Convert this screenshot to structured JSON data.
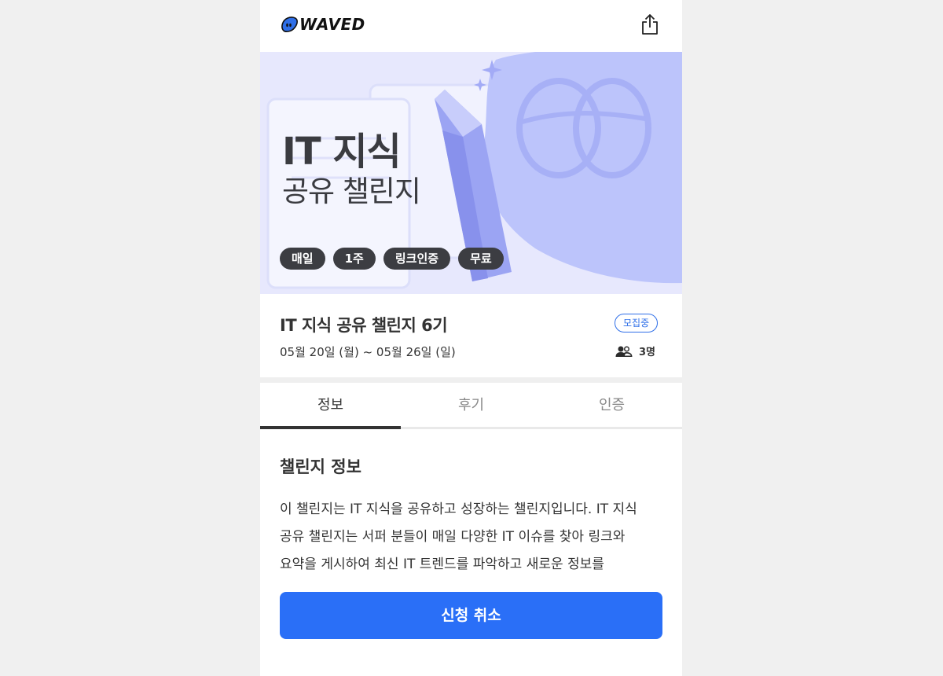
{
  "header": {
    "logo_text": "WAVED",
    "share_icon": "share-icon"
  },
  "hero": {
    "title": "IT 지식",
    "subtitle": "공유 챌린지",
    "chips": [
      "매일",
      "1주",
      "링크인증",
      "무료"
    ]
  },
  "challenge": {
    "title": "IT 지식 공유 챌린지 6기",
    "status": "모집중",
    "date_range": "05월 20일 (월) ~ 05월 26일 (일)",
    "members": "3명"
  },
  "tabs": {
    "items": [
      "정보",
      "후기",
      "인증"
    ],
    "active": "정보"
  },
  "section": {
    "title": "챌린지 정보",
    "description": "이 챌린지는 IT 지식을 공유하고 성장하는 챌린지입니다. IT 지식 공유 챌린지는 서퍼 분들이 매일 다양한 IT 이슈를 찾아 링크와 요약을 게시하여 최신 IT 트렌드를 파악하고 새로운 정보를"
  },
  "button": {
    "label": "신청 취소"
  },
  "colors": {
    "accent": "#2a6ff7",
    "hero_bg": "#e7e8fd",
    "chip_bg": "#3c3d42"
  }
}
